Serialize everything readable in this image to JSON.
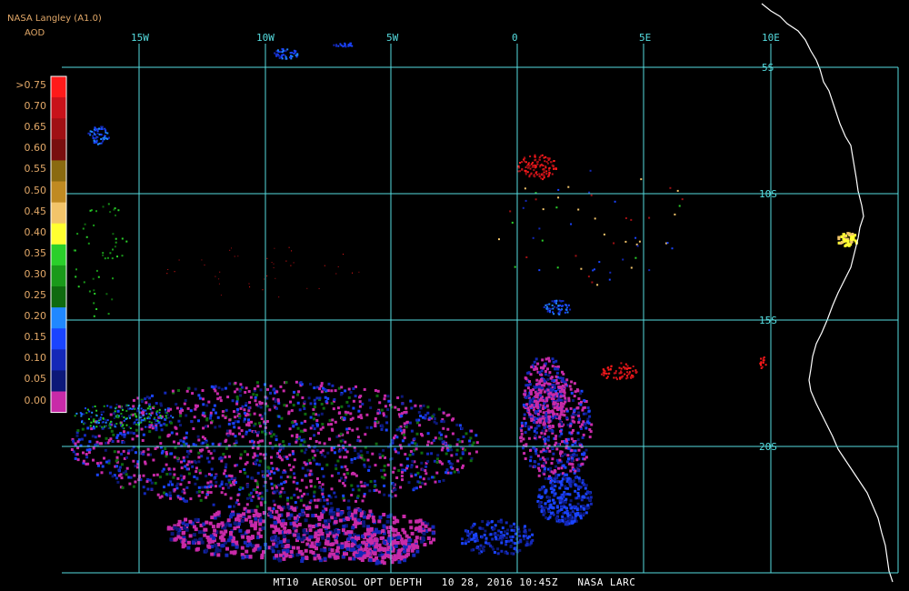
{
  "header": {
    "agency": "NASA Langley (A1.0)",
    "product": "AOD"
  },
  "legend": {
    "title": "AOD",
    "entries": [
      {
        "label": ">0.75",
        "color": "#ff1a1a"
      },
      {
        "label": "0.70",
        "color": "#c8121a"
      },
      {
        "label": "0.65",
        "color": "#a01014"
      },
      {
        "label": "0.60",
        "color": "#780e0e"
      },
      {
        "label": "0.55",
        "color": "#8a6a10"
      },
      {
        "label": "0.50",
        "color": "#c08a22"
      },
      {
        "label": "0.45",
        "color": "#f2c46a"
      },
      {
        "label": "0.40",
        "color": "#ffff30"
      },
      {
        "label": "0.35",
        "color": "#2ad02a"
      },
      {
        "label": "0.30",
        "color": "#1a9a1a"
      },
      {
        "label": "0.25",
        "color": "#0f6a0f"
      },
      {
        "label": "0.20",
        "color": "#2088ff"
      },
      {
        "label": "0.15",
        "color": "#1a44ff"
      },
      {
        "label": "0.10",
        "color": "#1428b8"
      },
      {
        "label": "0.05",
        "color": "#0c1878"
      },
      {
        "label": "0.00",
        "color": "#c82aa8"
      }
    ]
  },
  "grid": {
    "color": "#56dde0",
    "longitudes": [
      "15W",
      "10W",
      "5W",
      "0",
      "5E",
      "10E"
    ],
    "latitudes": [
      "5S",
      "10S",
      "15S",
      "20S"
    ]
  },
  "footer": {
    "caption": "MT10  AEROSOL OPT DEPTH   10 28, 2016 10:45Z   NASA LARC"
  },
  "colors": {
    "background": "#000000",
    "coastline": "#ffffff",
    "header_text": "#e2a868"
  }
}
